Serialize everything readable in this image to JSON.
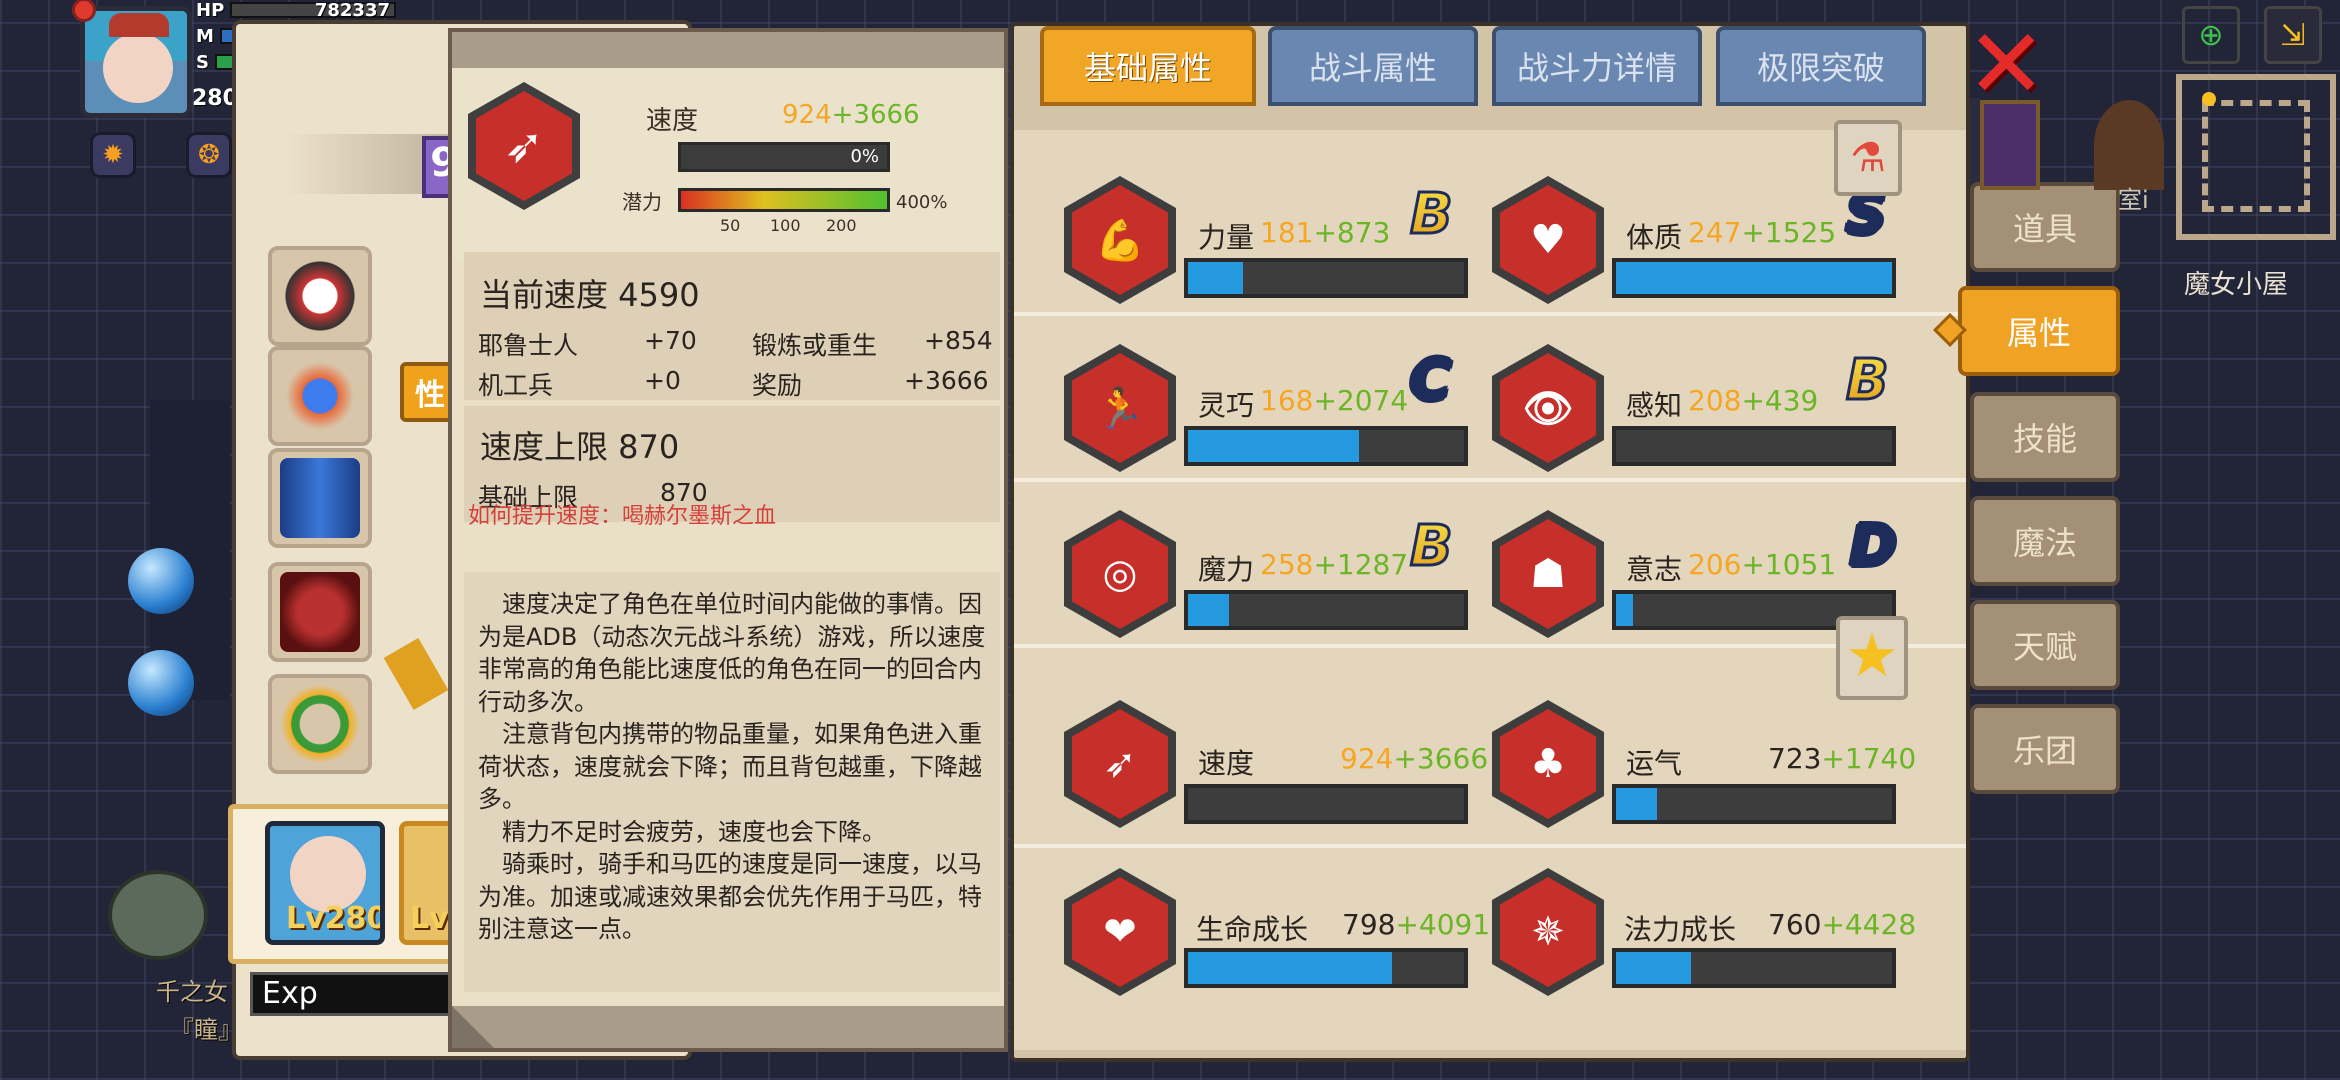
{
  "hud": {
    "hp_label": "HP",
    "hp_value": "782337",
    "mp_label": "M",
    "sp_label": "S",
    "level_partial": "280"
  },
  "left_panel": {
    "badge_text": "性",
    "number_badge": "9",
    "character_level": "Lv280",
    "second_card_level": "Lv",
    "exp_label": "Exp",
    "background_sign_1": "千之女",
    "background_sign_2": "『瞳』"
  },
  "tooltip": {
    "stat_name": "速度",
    "base_value": "924",
    "bonus_value": "+3666",
    "progress_percent": "0%",
    "progress_fraction": 0,
    "potential_label": "潜力",
    "potential_max": "400%",
    "potential_ticks": [
      "50",
      "100",
      "200"
    ],
    "current_title": "当前速度 4590",
    "breakdown": [
      {
        "label": "耶鲁士人",
        "value": "+70"
      },
      {
        "label": "锻炼或重生",
        "value": "+854"
      },
      {
        "label": "机工兵",
        "value": "+0"
      },
      {
        "label": "奖励",
        "value": "+3666"
      }
    ],
    "limit_title": "速度上限 870",
    "base_limit_label": "基础上限",
    "base_limit_value": "870",
    "how_to_improve": "如何提升速度：喝赫尔墨斯之血",
    "description": [
      "　速度决定了角色在单位时间内能做的事情。因为是ADB（动态次元战斗系统）游戏，所以速度非常高的角色能比速度低的角色在同一的回合内行动多次。",
      "　注意背包内携带的物品重量，如果角色进入重荷状态，速度就会下降；而且背包越重，下降越多。",
      "　精力不足时会疲劳，速度也会下降。",
      "　骑乘时，骑手和马匹的速度是同一速度，以马为准。加速或减速效果都会优先作用于马匹，特别注意这一点。"
    ]
  },
  "tabs": [
    "基础属性",
    "战斗属性",
    "战斗力详情",
    "极限突破"
  ],
  "side_tabs": [
    "道具",
    "属性",
    "技能",
    "魔法",
    "天赋",
    "乐团"
  ],
  "active_side_tab": "属性",
  "stats": [
    {
      "name": "力量",
      "base": "181",
      "bonus": "+873",
      "grade": "B",
      "fill": 0.2
    },
    {
      "name": "体质",
      "base": "247",
      "bonus": "+1525",
      "grade": "S",
      "fill": 1.0
    },
    {
      "name": "灵巧",
      "base": "168",
      "bonus": "+2074",
      "grade": "C",
      "fill": 0.62
    },
    {
      "name": "感知",
      "base": "208",
      "bonus": "+439",
      "grade": "B",
      "fill": 0.0
    },
    {
      "name": "魔力",
      "base": "258",
      "bonus": "+1287",
      "grade": "B",
      "fill": 0.15
    },
    {
      "name": "意志",
      "base": "206",
      "bonus": "+1051",
      "grade": "D",
      "fill": 0.06
    },
    {
      "name": "速度",
      "base": "924",
      "bonus": "+3666",
      "grade": "",
      "fill": 0.0
    },
    {
      "name": "运气",
      "base": "723",
      "bonus": "+1740",
      "grade": "",
      "fill": 0.15
    },
    {
      "name": "生命成长",
      "base": "798",
      "bonus": "+4091",
      "grade": "",
      "fill": 0.74
    },
    {
      "name": "法力成长",
      "base": "760",
      "bonus": "+4428",
      "grade": "",
      "fill": 0.27
    }
  ],
  "map": {
    "label": "魔女小屋",
    "side_text": "室i"
  },
  "colors": {
    "accent_orange": "#f2a625",
    "bar_blue": "#2599e0",
    "stat_red": "#c62f2a",
    "value_orange": "#f5a623",
    "value_green": "#6cb528"
  }
}
